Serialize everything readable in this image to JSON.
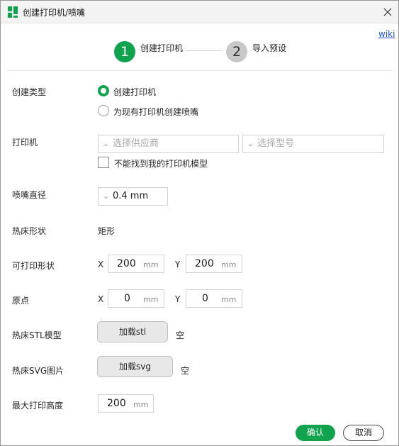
{
  "window": {
    "title": "创建打印机/喷嘴",
    "icon": "app-logo-icon",
    "close_icon": "close-icon",
    "brand_color": "#10a34e"
  },
  "wiki_link": "wiki",
  "steps": [
    {
      "number": "1",
      "label": "创建打印机",
      "active": true
    },
    {
      "number": "2",
      "label": "导入预设",
      "active": false
    }
  ],
  "create_type": {
    "label": "创建类型",
    "options": [
      {
        "label": "创建打印机",
        "checked": true
      },
      {
        "label": "为现有打印机创建喷嘴",
        "checked": false
      }
    ]
  },
  "printer": {
    "label": "打印机",
    "vendor_placeholder": "选择供应商",
    "model_placeholder": "选择型号",
    "cant_find_label": "不能找到我的打印机模型",
    "cant_find_checked": false
  },
  "nozzle": {
    "label": "喷嘴直径",
    "value": "0.4 mm"
  },
  "bed_shape": {
    "label": "热床形状",
    "value": "矩形"
  },
  "printable_area": {
    "label": "可打印形状",
    "x_label": "X",
    "x_value": "200",
    "y_label": "Y",
    "y_value": "200",
    "unit": "mm"
  },
  "origin": {
    "label": "原点",
    "x_label": "X",
    "x_value": "0",
    "y_label": "Y",
    "y_value": "0",
    "unit": "mm"
  },
  "bed_stl": {
    "label": "热床STL模型",
    "button": "加载stl",
    "status": "空"
  },
  "bed_svg": {
    "label": "热床SVG图片",
    "button": "加载svg",
    "status": "空"
  },
  "max_height": {
    "label": "最大打印高度",
    "value": "200",
    "unit": "mm"
  },
  "footer": {
    "ok": "确认",
    "cancel": "取消"
  }
}
